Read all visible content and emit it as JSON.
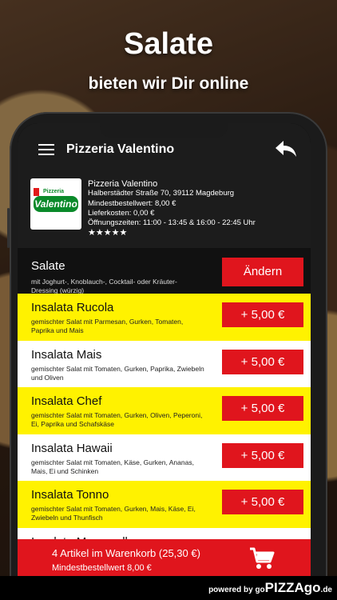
{
  "promo": {
    "headline": "Salate",
    "subline": "bieten wir Dir online"
  },
  "app": {
    "title": "Pizzeria Valentino"
  },
  "shop": {
    "name": "Pizzeria Valentino",
    "address": "Halberstädter Straße 70, 39112 Magdeburg",
    "min_order": "Mindestbestellwert: 8,00 €",
    "delivery_cost": "Lieferkosten: 0,00 €",
    "hours": "Öffnungszeiten: 11:00 - 13:45 & 16:00 - 22:45 Uhr",
    "stars": "★★★★★",
    "logo_text": "Valentino",
    "logo_small": "Pizzeria"
  },
  "category": {
    "title": "Salate",
    "description": "mit Joghurt-, Knoblauch-, Cocktail- oder Kräuter-Dressing (würzig)",
    "change_label": "Ändern"
  },
  "items": [
    {
      "name": "Insalata Rucola",
      "description": "gemischter Salat mit Parmesan, Gurken, Tomaten, Paprika und Mais",
      "price": "+ 5,00 €"
    },
    {
      "name": "Insalata Mais",
      "description": "gemischter Salat mit Tomaten, Gurken, Paprika, Zwiebeln und Oliven",
      "price": "+ 5,00 €"
    },
    {
      "name": "Insalata Chef",
      "description": "gemischter Salat mit Tomaten, Gurken, Oliven, Peperoni, Ei, Paprika und Schafskäse",
      "price": "+ 5,00 €"
    },
    {
      "name": "Insalata Hawaii",
      "description": "gemischter Salat mit Tomaten, Käse, Gurken, Ananas, Mais, Ei und Schinken",
      "price": "+ 5,00 €"
    },
    {
      "name": "Insalata Tonno",
      "description": "gemischter Salat mit Tomaten, Gurken, Mais, Käse, Ei, Zwiebeln und Thunfisch",
      "price": "+ 5,00 €"
    },
    {
      "name": "Insalata Mozzarella",
      "description": "",
      "price": ""
    }
  ],
  "cart": {
    "summary": "4 Artikel im Warenkorb (25,30 €)",
    "min_order": "Mindestbestellwert 8,00 €"
  },
  "footer": {
    "powered": "powered by",
    "brand_go": "go",
    "brand": "PIZZA",
    "brand_go2": "go",
    "brand_tld": ".de"
  },
  "colors": {
    "accent_red": "#e0151d",
    "highlight_yellow": "#fff200",
    "bar_dark": "#1c1c1c"
  },
  "icons": [
    "menu-icon",
    "back-arrow-icon",
    "shopping-cart-icon",
    "star-icon"
  ]
}
